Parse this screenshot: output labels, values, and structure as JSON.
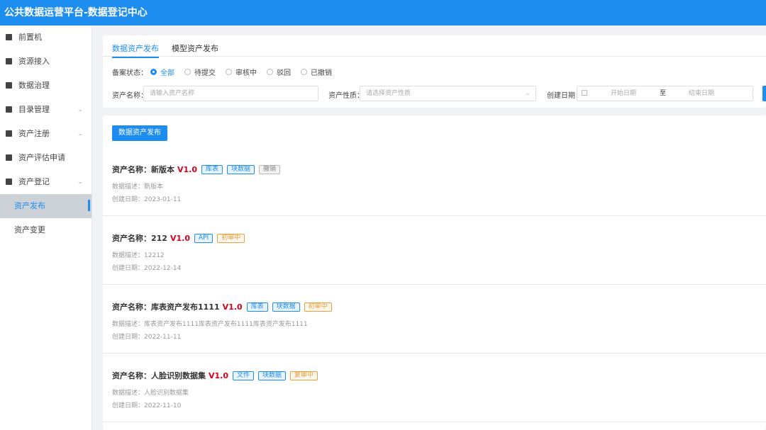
{
  "app_title": "公共数据运营平台-数据登记中心",
  "sidebar": {
    "items": [
      {
        "label": "前置机",
        "icon": "monitor-icon"
      },
      {
        "label": "资源接入",
        "icon": "plug-icon"
      },
      {
        "label": "数据治理",
        "icon": "monitor-icon"
      },
      {
        "label": "目录管理",
        "icon": "folder-icon",
        "chevron": "⌄"
      },
      {
        "label": "资产注册",
        "icon": "folder-icon",
        "chevron": "⌄"
      },
      {
        "label": "资产评估申请",
        "icon": "file-icon"
      },
      {
        "label": "资产登记",
        "icon": "folder-icon",
        "chevron": "⌄"
      }
    ],
    "subitems": [
      {
        "label": "资产发布",
        "active": true
      },
      {
        "label": "资产变更",
        "active": false
      }
    ]
  },
  "tabs": [
    "数据资产发布",
    "模型资产发布"
  ],
  "filters": {
    "status_label": "备案状态：",
    "status_options": [
      "全部",
      "待提交",
      "审核中",
      "驳回",
      "已撤销"
    ],
    "name_label": "资产名称：",
    "name_placeholder": "请输入资产名称",
    "type_label": "资产性质：",
    "type_placeholder": "请选择资产性质",
    "date_label": "创建日期：",
    "date_start": "开始日期",
    "date_sep": "至",
    "date_end": "结束日期"
  },
  "publish_button": "数据资产发布",
  "name_prefix": "资产名称：",
  "desc_prefix": "数据描述：",
  "date_prefix": "创建日期：",
  "assets": [
    {
      "name": "新版本",
      "version": "V1.0",
      "tags": [
        {
          "text": "库表",
          "color": "blue"
        },
        {
          "text": "块数据",
          "color": "blue"
        },
        {
          "text": "撤销",
          "color": "grey"
        }
      ],
      "desc": "新版本",
      "date": "2023-01-11"
    },
    {
      "name": "212",
      "version": "V1.0",
      "tags": [
        {
          "text": "API",
          "color": "blue"
        },
        {
          "text": "初审中",
          "color": "orange"
        }
      ],
      "desc": "12212",
      "date": "2022-12-14"
    },
    {
      "name": "库表资产发布1111",
      "version": "V1.0",
      "tags": [
        {
          "text": "库表",
          "color": "blue"
        },
        {
          "text": "块数据",
          "color": "blue"
        },
        {
          "text": "初审中",
          "color": "orange"
        }
      ],
      "desc": "库表资产发布1111库表资产发布1111库表资产发布1111",
      "date": "2022-11-11"
    },
    {
      "name": "人脸识别数据集",
      "version": "V1.0",
      "tags": [
        {
          "text": "文件",
          "color": "blue"
        },
        {
          "text": "块数据",
          "color": "blue"
        },
        {
          "text": "复审中",
          "color": "orange"
        }
      ],
      "desc": "人脸识别数据集",
      "date": "2022-11-10"
    }
  ]
}
